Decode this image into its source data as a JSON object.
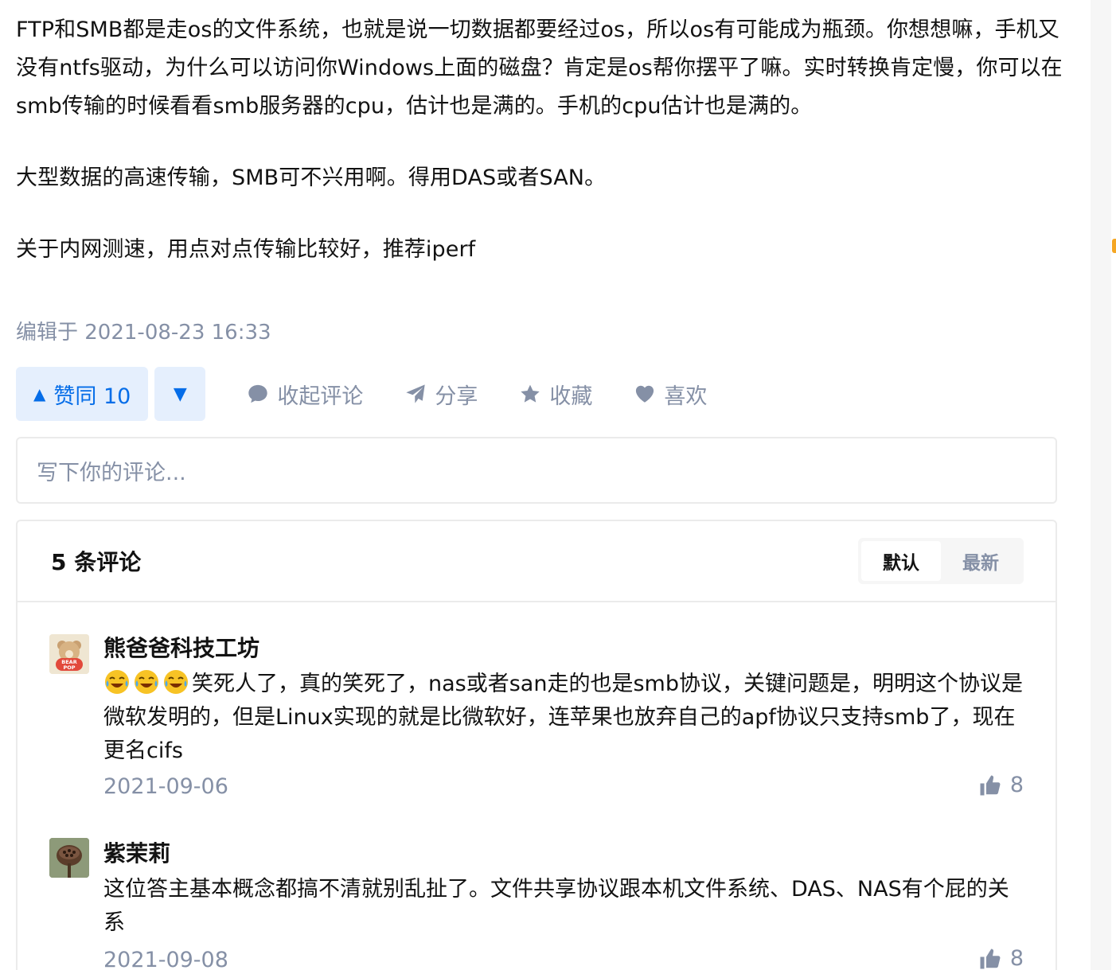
{
  "answer": {
    "paragraphs": [
      "FTP和SMB都是走os的文件系统，也就是说一切数据都要经过os，所以os有可能成为瓶颈。你想想嘛，手机又没有ntfs驱动，为什么可以访问你Windows上面的磁盘？肯定是os帮你摆平了嘛。实时转换肯定慢，你可以在smb传输的时候看看smb服务器的cpu，估计也是满的。手机的cpu估计也是满的。",
      "大型数据的高速传输，SMB可不兴用啊。得用DAS或者SAN。",
      "关于内网测速，用点对点传输比较好，推荐iperf"
    ],
    "edited": "编辑于 2021-08-23 16:33"
  },
  "actions": {
    "upvote_label": "赞同 10",
    "upvote_icon": "triangle-up-icon",
    "downvote_icon": "triangle-down-icon",
    "collapse_comments": "收起评论",
    "share": "分享",
    "favorite": "收藏",
    "like": "喜欢"
  },
  "comment_input": {
    "placeholder": "写下你的评论..."
  },
  "comments": {
    "title": "5 条评论",
    "sort_options": [
      "默认",
      "最新"
    ],
    "sort_selected": "默认",
    "items": [
      {
        "author": "熊爸爸科技工坊",
        "avatar_text": "BEAR POP",
        "emoji": "laughing-crying-emoji",
        "text": "笑死人了，真的笑死了，nas或者san走的也是smb协议，关键问题是，明明这个协议是微软发明的，但是Linux实现的就是比微软好，连苹果也放弃自己的apf协议只支持smb了，现在更名cifs",
        "date": "2021-09-06",
        "likes": "8"
      },
      {
        "author": "紫茉莉",
        "text": "这位答主基本概念都搞不清就别乱扯了。文件共享协议跟本机文件系统、DAS、NAS有个屁的关系",
        "date": "2021-09-08",
        "likes": "8"
      }
    ]
  },
  "colors": {
    "accent": "#056de8",
    "accent_bg": "#e5effd",
    "muted": "#8590a6",
    "border": "#ebebeb"
  }
}
